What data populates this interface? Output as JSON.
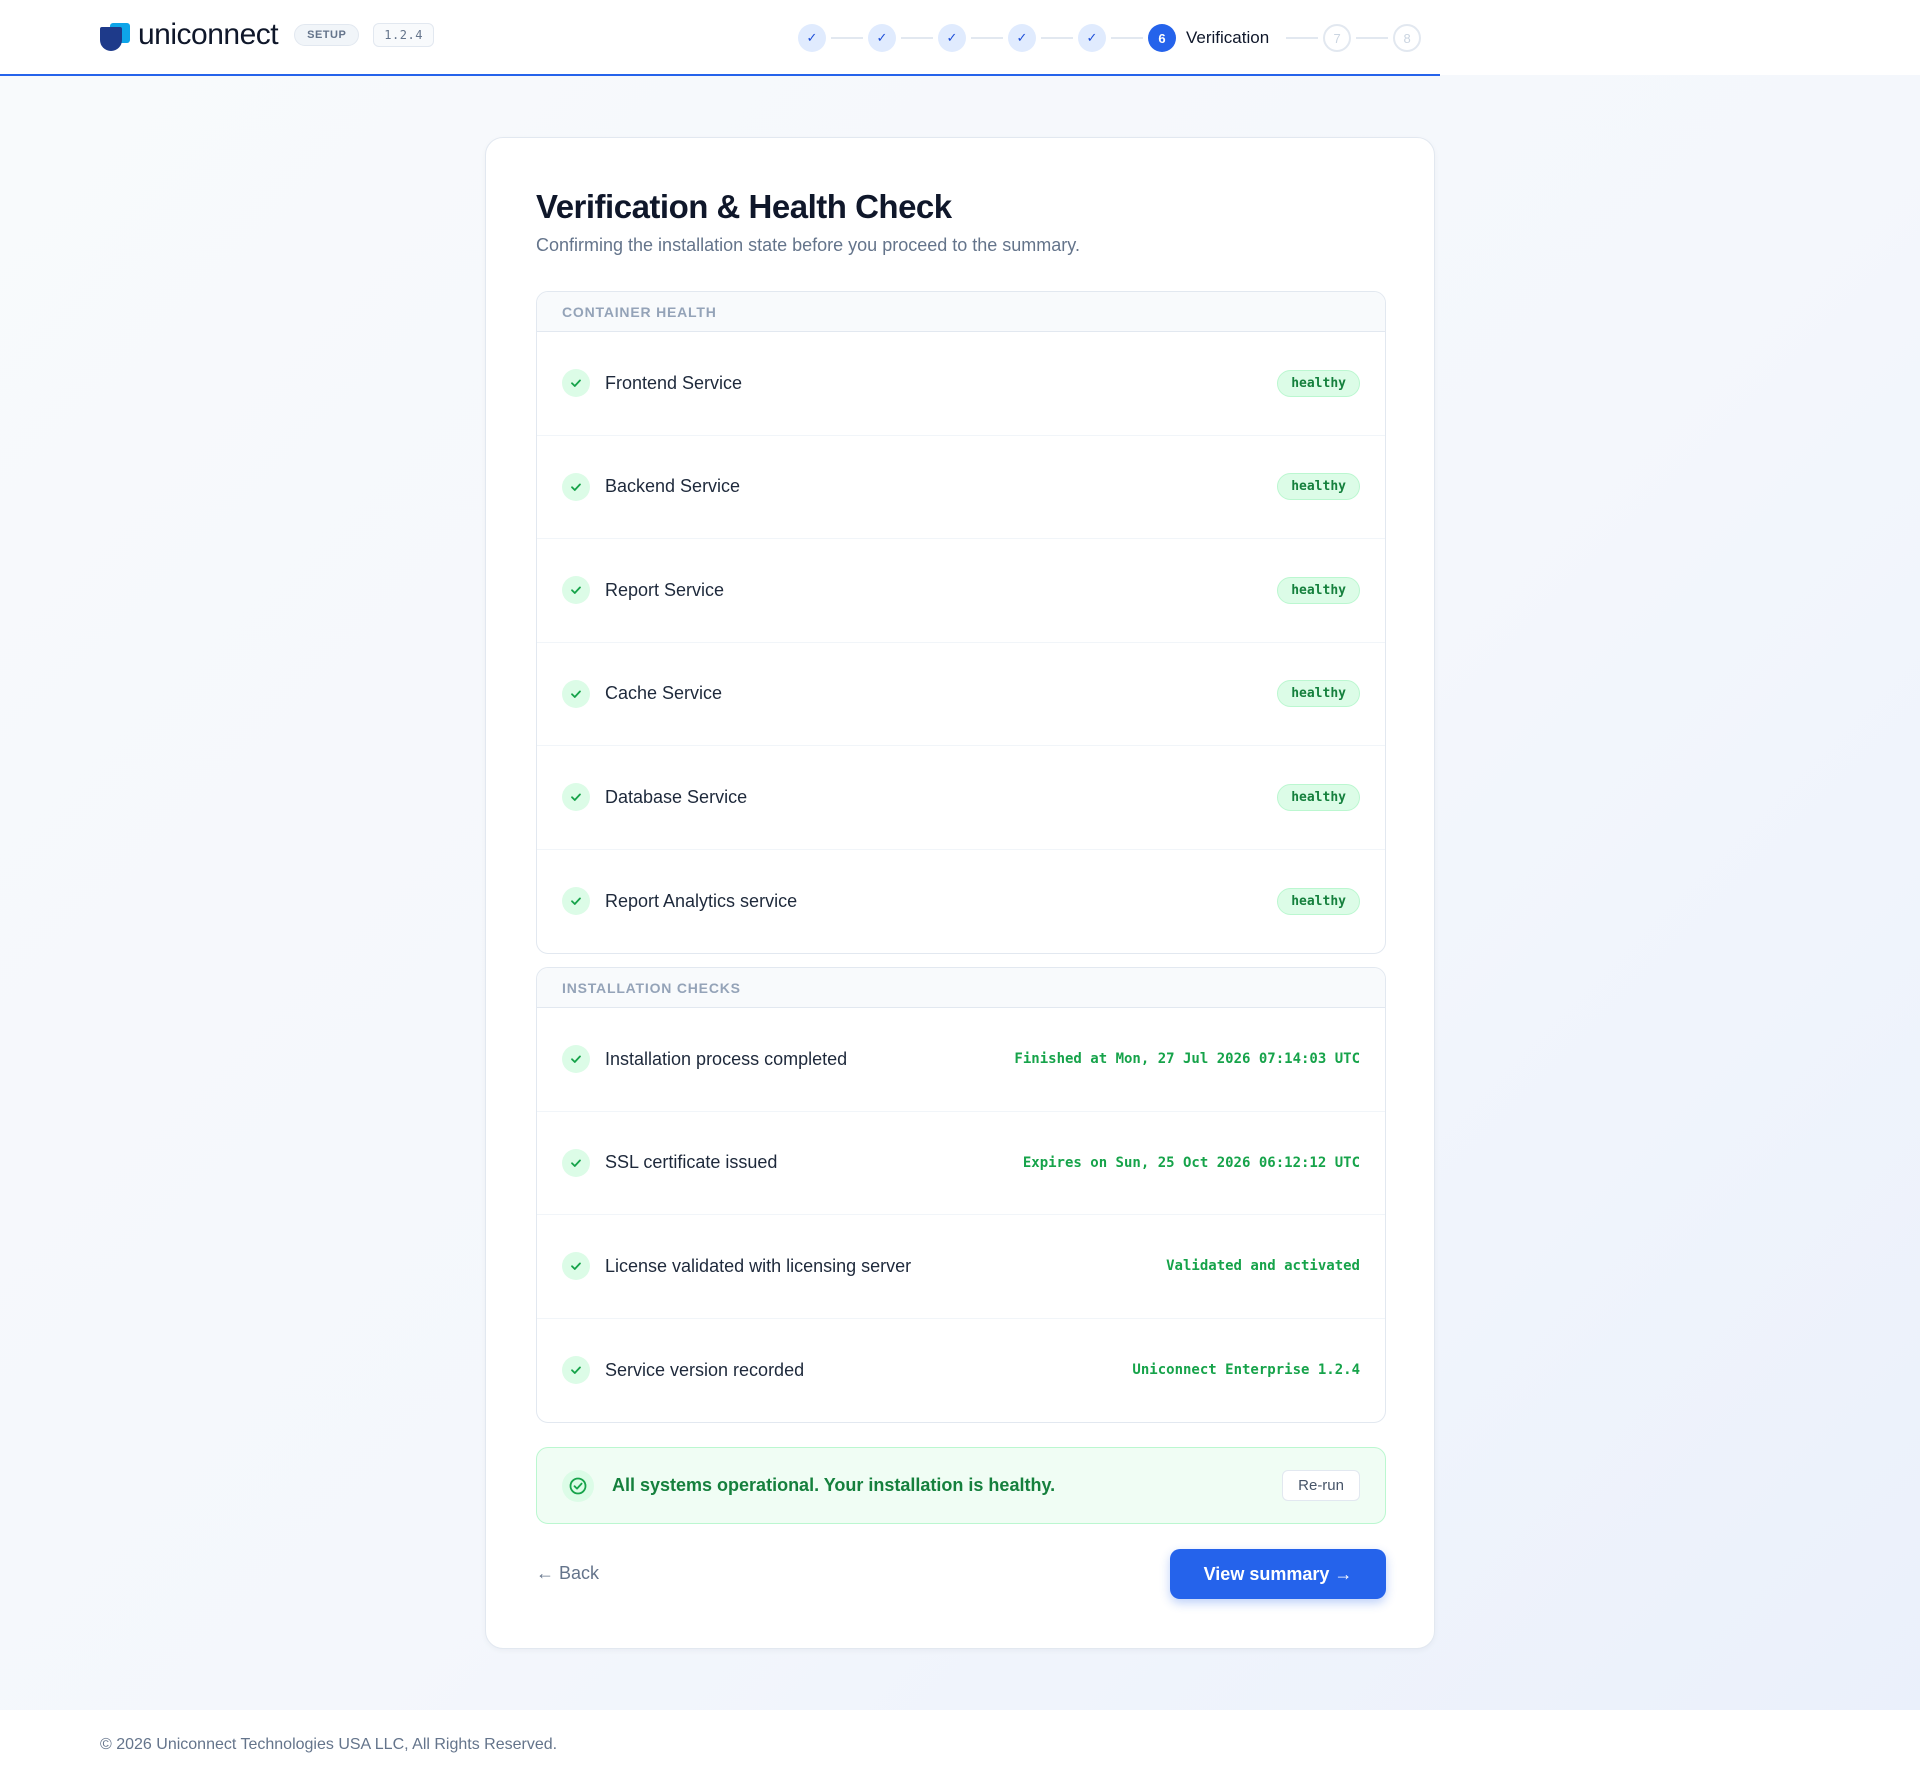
{
  "header": {
    "brand": "uniconnect",
    "mode_badge": "SETUP",
    "version": "1.2.4",
    "steps": [
      {
        "state": "done",
        "label": ""
      },
      {
        "state": "done",
        "label": ""
      },
      {
        "state": "done",
        "label": ""
      },
      {
        "state": "done",
        "label": ""
      },
      {
        "state": "done",
        "label": ""
      },
      {
        "state": "current",
        "number": "6",
        "label": "Verification"
      },
      {
        "state": "todo",
        "number": "7",
        "label": ""
      },
      {
        "state": "todo",
        "number": "8",
        "label": ""
      }
    ],
    "check_glyph": "✓"
  },
  "page": {
    "title": "Verification & Health Check",
    "subtitle": "Confirming the installation state before you proceed to the summary."
  },
  "container_health": {
    "heading": "CONTAINER HEALTH",
    "items": [
      {
        "label": "Frontend Service",
        "status": "healthy"
      },
      {
        "label": "Backend Service",
        "status": "healthy"
      },
      {
        "label": "Report Service",
        "status": "healthy"
      },
      {
        "label": "Cache Service",
        "status": "healthy"
      },
      {
        "label": "Database Service",
        "status": "healthy"
      },
      {
        "label": "Report Analytics service",
        "status": "healthy"
      }
    ]
  },
  "installation_checks": {
    "heading": "INSTALLATION CHECKS",
    "items": [
      {
        "label": "Installation process completed",
        "detail": "Finished at Mon, 27 Jul 2026 07:14:03 UTC"
      },
      {
        "label": "SSL certificate issued",
        "detail": "Expires on Sun, 25 Oct 2026 06:12:12 UTC"
      },
      {
        "label": "License validated with licensing server",
        "detail": "Validated and activated"
      },
      {
        "label": "Service version recorded",
        "detail": "Uniconnect Enterprise 1.2.4"
      }
    ]
  },
  "status_banner": {
    "message": "All systems operational. Your installation is healthy.",
    "rerun_label": "Re-run"
  },
  "actions": {
    "back_label": "← Back",
    "next_label": "View summary →"
  },
  "footer": {
    "copyright": "© 2026 Uniconnect Technologies USA LLC, All Rights Reserved."
  },
  "colors": {
    "accent": "#2563eb",
    "success": "#16a34a",
    "success_bg": "#dcfce7"
  },
  "icons": {
    "brand": "uniconnect-logo-icon",
    "check": "check-icon",
    "banner": "check-circle-icon"
  }
}
